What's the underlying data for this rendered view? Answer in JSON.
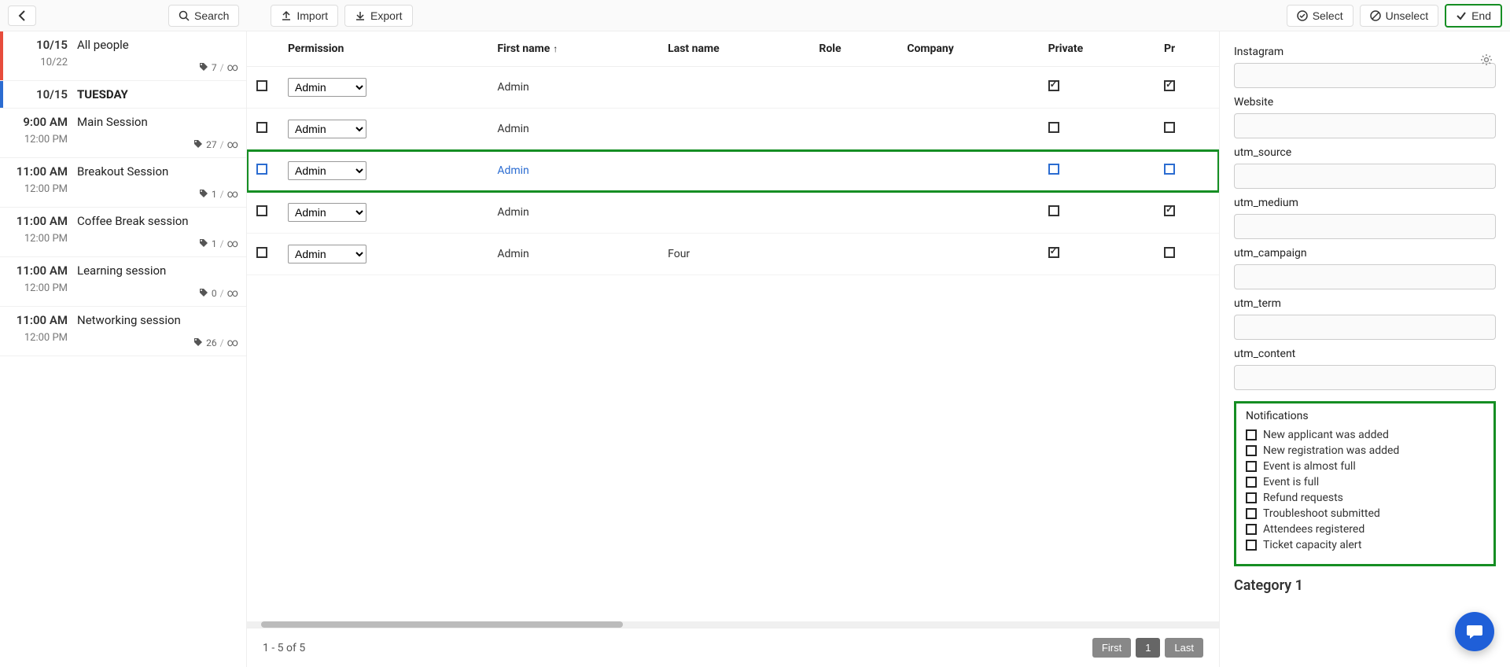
{
  "topbar": {
    "search": "Search",
    "import": "Import",
    "export": "Export",
    "select": "Select",
    "unselect": "Unselect",
    "end": "End"
  },
  "sidebar": {
    "items": [
      {
        "t1": "10/15",
        "t2": "10/22",
        "title": "All people",
        "count": "7",
        "inf": "∞",
        "bar": "red",
        "bold": false
      },
      {
        "t1": "10/15",
        "t2": "",
        "title": "TUESDAY",
        "count": "",
        "inf": "",
        "bar": "blue",
        "bold": true
      },
      {
        "t1": "9:00 AM",
        "t2": "12:00 PM",
        "title": "Main Session",
        "count": "27",
        "inf": "∞",
        "bar": "",
        "bold": false
      },
      {
        "t1": "11:00 AM",
        "t2": "12:00 PM",
        "title": "Breakout Session",
        "count": "1",
        "inf": "∞",
        "bar": "",
        "bold": false
      },
      {
        "t1": "11:00 AM",
        "t2": "12:00 PM",
        "title": "Coffee Break session",
        "count": "1",
        "inf": "∞",
        "bar": "",
        "bold": false
      },
      {
        "t1": "11:00 AM",
        "t2": "12:00 PM",
        "title": "Learning session",
        "count": "0",
        "inf": "∞",
        "bar": "",
        "bold": false
      },
      {
        "t1": "11:00 AM",
        "t2": "12:00 PM",
        "title": "Networking session",
        "count": "26",
        "inf": "∞",
        "bar": "",
        "bold": false
      }
    ]
  },
  "table": {
    "headers": {
      "permission": "Permission",
      "firstname": "First name",
      "lastname": "Last name",
      "role": "Role",
      "company": "Company",
      "private": "Private",
      "pr2": "Pr"
    },
    "rows": [
      {
        "perm": "Admin",
        "first": "Admin",
        "last": "",
        "role": "",
        "company": "",
        "private": true,
        "pr2": true,
        "selected": false
      },
      {
        "perm": "Admin",
        "first": "Admin",
        "last": "",
        "role": "",
        "company": "",
        "private": false,
        "pr2": false,
        "selected": false
      },
      {
        "perm": "Admin",
        "first": "Admin",
        "last": "",
        "role": "",
        "company": "",
        "private": false,
        "pr2": false,
        "selected": true
      },
      {
        "perm": "Admin",
        "first": "Admin",
        "last": "",
        "role": "",
        "company": "",
        "private": false,
        "pr2": true,
        "selected": false
      },
      {
        "perm": "Admin",
        "first": "Admin",
        "last": "Four",
        "role": "",
        "company": "",
        "private": true,
        "pr2": false,
        "selected": false
      }
    ],
    "pager": {
      "info": "1 - 5 of 5",
      "first": "First",
      "page": "1",
      "last": "Last"
    }
  },
  "right": {
    "fields": [
      {
        "label": "Instagram",
        "value": ""
      },
      {
        "label": "Website",
        "value": ""
      },
      {
        "label": "utm_source",
        "value": ""
      },
      {
        "label": "utm_medium",
        "value": ""
      },
      {
        "label": "utm_campaign",
        "value": ""
      },
      {
        "label": "utm_term",
        "value": ""
      },
      {
        "label": "utm_content",
        "value": ""
      }
    ],
    "notifications": {
      "title": "Notifications",
      "items": [
        "New applicant was added",
        "New registration was added",
        "Event is almost full",
        "Event is full",
        "Refund requests",
        "Troubleshoot submitted",
        "Attendees registered",
        "Ticket capacity alert"
      ]
    },
    "category": "Category 1"
  }
}
